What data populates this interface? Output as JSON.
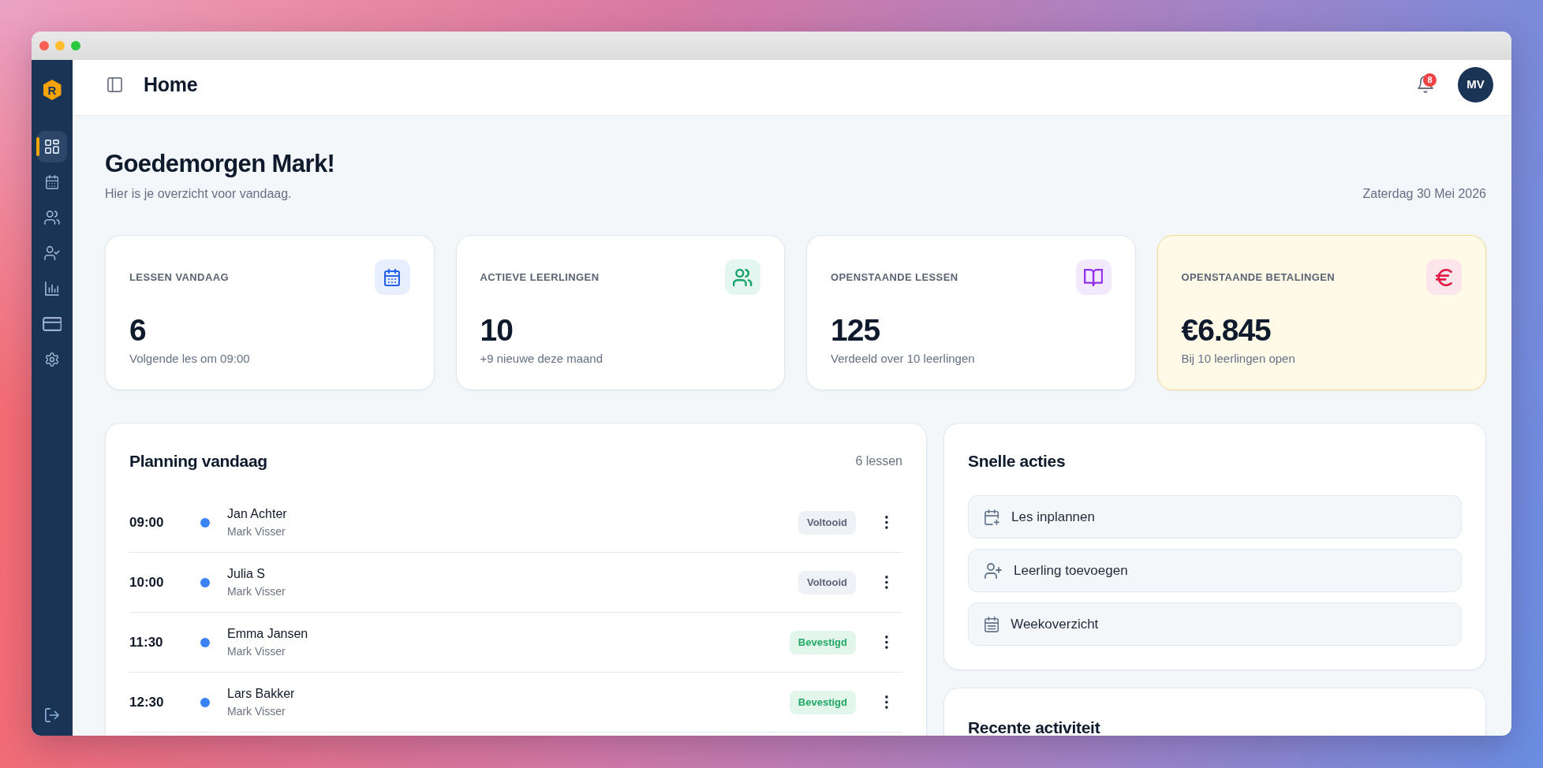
{
  "logo": {
    "letter": "R"
  },
  "sidebar": {
    "items": [
      {
        "selected": true
      },
      {
        "selected": false
      },
      {
        "selected": false
      },
      {
        "selected": false
      },
      {
        "selected": false
      },
      {
        "selected": false
      },
      {
        "selected": false
      }
    ]
  },
  "header": {
    "title": "Home",
    "notifications": {
      "count": "8"
    },
    "user": {
      "initials": "MV"
    }
  },
  "greeting": {
    "title": "Goedemorgen Mark!",
    "subtitle": "Hier is je overzicht voor vandaag.",
    "date": "Zaterdag 30 Mei 2026"
  },
  "stats": [
    {
      "label": "LESSEN VANDAAG",
      "value": "6",
      "note": "Volgende les om 09:00",
      "color": "#2563eb",
      "highlighted": false
    },
    {
      "label": "ACTIEVE LEERLINGEN",
      "value": "10",
      "note": "+9 nieuwe deze maand",
      "color": "#16a36b",
      "highlighted": false
    },
    {
      "label": "OPENSTAANDE LESSEN",
      "value": "125",
      "note": "Verdeeld over 10 leerlingen",
      "color": "#9333ea",
      "highlighted": false
    },
    {
      "label": "OPENSTAANDE BETALINGEN",
      "value": "€6.845",
      "note": "Bij 10 leerlingen open",
      "color": "#e11d48",
      "highlighted": true
    }
  ],
  "planning": {
    "title": "Planning vandaag",
    "count": "6 lessen",
    "rows": [
      {
        "time": "09:00",
        "student": "Jan Achter",
        "instructor": "Mark Visser",
        "color": "#3b82f6",
        "status": {
          "label": "Voltooid",
          "kind": "done"
        }
      },
      {
        "time": "10:00",
        "student": "Julia S",
        "instructor": "Mark Visser",
        "color": "#3b82f6",
        "status": {
          "label": "Voltooid",
          "kind": "done"
        }
      },
      {
        "time": "11:30",
        "student": "Emma Jansen",
        "instructor": "Mark Visser",
        "color": "#3b82f6",
        "status": {
          "label": "Bevestigd",
          "kind": "confirmed"
        }
      },
      {
        "time": "12:30",
        "student": "Lars Bakker",
        "instructor": "Mark Visser",
        "color": "#3b82f6",
        "status": {
          "label": "Bevestigd",
          "kind": "confirmed"
        }
      }
    ]
  },
  "quick_actions": {
    "title": "Snelle acties",
    "items": [
      {
        "label": "Les inplannen"
      },
      {
        "label": "Leerling toevoegen"
      },
      {
        "label": "Weekoverzicht"
      }
    ]
  },
  "recent_activity": {
    "title": "Recente activiteit"
  }
}
